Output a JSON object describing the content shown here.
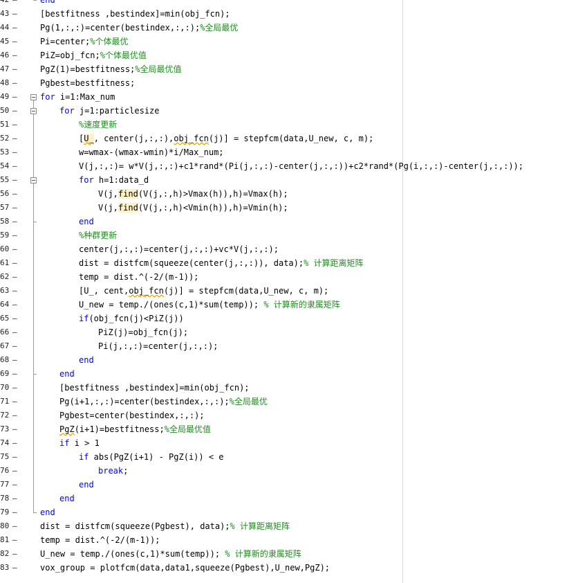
{
  "editor": {
    "lines": [
      {
        "num": "42",
        "segments": [
          {
            "t": "end",
            "c": "kw"
          }
        ]
      },
      {
        "num": "43",
        "segments": [
          {
            "t": "[bestfitness ,bestindex]=min(obj_fcn);",
            "c": ""
          }
        ]
      },
      {
        "num": "44",
        "segments": [
          {
            "t": "Pg(1,:,:)=center(bestindex,:,:);",
            "c": ""
          },
          {
            "t": "%全局最优",
            "c": "cm"
          }
        ]
      },
      {
        "num": "45",
        "segments": [
          {
            "t": "Pi=center;",
            "c": ""
          },
          {
            "t": "%个体最优",
            "c": "cm"
          }
        ]
      },
      {
        "num": "46",
        "segments": [
          {
            "t": "PiZ=obj_fcn;",
            "c": ""
          },
          {
            "t": "%个体最优值",
            "c": "cm"
          }
        ]
      },
      {
        "num": "47",
        "segments": [
          {
            "t": "PgZ(1)=bestfitness;",
            "c": ""
          },
          {
            "t": "%全局最优值",
            "c": "cm"
          }
        ]
      },
      {
        "num": "48",
        "segments": [
          {
            "t": "Pgbest=bestfitness;",
            "c": ""
          }
        ]
      },
      {
        "num": "49",
        "segments": [
          {
            "t": "for",
            "c": "kw"
          },
          {
            "t": " i=1:Max_num",
            "c": ""
          }
        ]
      },
      {
        "num": "50",
        "segments": [
          {
            "t": "for",
            "c": "kw"
          },
          {
            "t": " j=1:particlesize",
            "c": ""
          }
        ]
      },
      {
        "num": "51",
        "segments": [
          {
            "t": "%速度更新",
            "c": "cm"
          }
        ]
      },
      {
        "num": "52",
        "segments": [
          {
            "t": "[",
            "c": ""
          },
          {
            "t": "U_",
            "c": "sq hl"
          },
          {
            "t": ", center(j,:,:),",
            "c": ""
          },
          {
            "t": "obj_fcn",
            "c": "sq"
          },
          {
            "t": "(j)] = stepfcm(data,U_new, c, m);",
            "c": ""
          }
        ]
      },
      {
        "num": "53",
        "segments": [
          {
            "t": "w=wmax-(wmax-wmin)*i/Max_num;",
            "c": ""
          }
        ]
      },
      {
        "num": "54",
        "segments": [
          {
            "t": "V(j,:,:)= w*V(j,:,:)+c1*rand*(Pi(j,:,:)-center(j,:,:))+c2*rand*(Pg(i,:,:)-center(j,:,:));",
            "c": ""
          }
        ]
      },
      {
        "num": "55",
        "segments": [
          {
            "t": "for",
            "c": "kw"
          },
          {
            "t": " h=1:data_d",
            "c": ""
          }
        ]
      },
      {
        "num": "56",
        "segments": [
          {
            "t": "V(j,",
            "c": ""
          },
          {
            "t": "find",
            "c": "hl"
          },
          {
            "t": "(V(j,:,h)>Vmax(h)),h)=Vmax(h);",
            "c": ""
          }
        ]
      },
      {
        "num": "57",
        "segments": [
          {
            "t": "V(j,",
            "c": ""
          },
          {
            "t": "find",
            "c": "hl"
          },
          {
            "t": "(V(j,:,h)<Vmin(h)),h)=Vmin(h);",
            "c": ""
          }
        ]
      },
      {
        "num": "58",
        "segments": [
          {
            "t": "end",
            "c": "kw"
          }
        ]
      },
      {
        "num": "59",
        "segments": [
          {
            "t": "%种群更新",
            "c": "cm"
          }
        ]
      },
      {
        "num": "60",
        "segments": [
          {
            "t": "center(j,:,:)=center(j,:,:)+vc*V(j,:,:);",
            "c": ""
          }
        ]
      },
      {
        "num": "61",
        "segments": [
          {
            "t": "dist = distfcm(squeeze(center(j,:,:)), data);",
            "c": ""
          },
          {
            "t": "% 计算距离矩阵",
            "c": "cm"
          }
        ]
      },
      {
        "num": "62",
        "segments": [
          {
            "t": "temp = dist.^(-2/(m-1));",
            "c": ""
          }
        ]
      },
      {
        "num": "63",
        "segments": [
          {
            "t": "[U_, cent,",
            "c": ""
          },
          {
            "t": "obj_fcn",
            "c": "sq"
          },
          {
            "t": "(j)] = stepfcm(data,U_new, c, m);",
            "c": ""
          }
        ]
      },
      {
        "num": "64",
        "segments": [
          {
            "t": "U_new = temp./(ones(c,1)*sum(temp)); ",
            "c": ""
          },
          {
            "t": "% 计算新的隶属矩阵",
            "c": "cm"
          }
        ]
      },
      {
        "num": "65",
        "segments": [
          {
            "t": "if",
            "c": "kw"
          },
          {
            "t": "(obj_fcn(j)<PiZ(j))",
            "c": ""
          }
        ]
      },
      {
        "num": "66",
        "segments": [
          {
            "t": "PiZ(j)=obj_fcn(j);",
            "c": ""
          }
        ]
      },
      {
        "num": "67",
        "segments": [
          {
            "t": "Pi(j,:,:)=center(j,:,:);",
            "c": ""
          }
        ]
      },
      {
        "num": "68",
        "segments": [
          {
            "t": "end",
            "c": "kw"
          }
        ]
      },
      {
        "num": "69",
        "segments": [
          {
            "t": "end",
            "c": "kw"
          }
        ]
      },
      {
        "num": "70",
        "segments": [
          {
            "t": "[bestfitness ,bestindex]=min(obj_fcn);",
            "c": ""
          }
        ]
      },
      {
        "num": "71",
        "segments": [
          {
            "t": "Pg(i+1,:,:)=center(bestindex,:,:);",
            "c": ""
          },
          {
            "t": "%全局最优",
            "c": "cm"
          }
        ]
      },
      {
        "num": "72",
        "segments": [
          {
            "t": "Pgbest=center(bestindex,:,:);",
            "c": ""
          }
        ]
      },
      {
        "num": "73",
        "segments": [
          {
            "t": "PgZ",
            "c": "sq"
          },
          {
            "t": "(i+1)=bestfitness;",
            "c": ""
          },
          {
            "t": "%全局最优值",
            "c": "cm"
          }
        ]
      },
      {
        "num": "74",
        "segments": [
          {
            "t": "if",
            "c": "kw"
          },
          {
            "t": " i > 1",
            "c": ""
          }
        ]
      },
      {
        "num": "75",
        "segments": [
          {
            "t": "if",
            "c": "kw"
          },
          {
            "t": " abs(PgZ(i+1) - PgZ(i)) < e",
            "c": ""
          }
        ]
      },
      {
        "num": "76",
        "segments": [
          {
            "t": "break",
            "c": "kw"
          },
          {
            "t": ";",
            "c": ""
          }
        ]
      },
      {
        "num": "77",
        "segments": [
          {
            "t": "end",
            "c": "kw"
          }
        ]
      },
      {
        "num": "78",
        "segments": [
          {
            "t": "end",
            "c": "kw"
          }
        ]
      },
      {
        "num": "79",
        "segments": [
          {
            "t": "end",
            "c": "kw"
          }
        ]
      },
      {
        "num": "80",
        "segments": [
          {
            "t": "dist = distfcm(squeeze(Pgbest), data);",
            "c": ""
          },
          {
            "t": "% 计算距离矩阵",
            "c": "cm"
          }
        ]
      },
      {
        "num": "81",
        "segments": [
          {
            "t": "temp = dist.^(-2/(m-1));",
            "c": ""
          }
        ]
      },
      {
        "num": "82",
        "segments": [
          {
            "t": "U_new = temp./(ones(c,1)*sum(temp)); ",
            "c": ""
          },
          {
            "t": "% 计算新的隶属矩阵",
            "c": "cm"
          }
        ]
      },
      {
        "num": "83",
        "segments": [
          {
            "t": "vox_group = plotfcm(data,data1,squeeze(Pgbest),U_new,PgZ);",
            "c": ""
          }
        ]
      }
    ]
  }
}
